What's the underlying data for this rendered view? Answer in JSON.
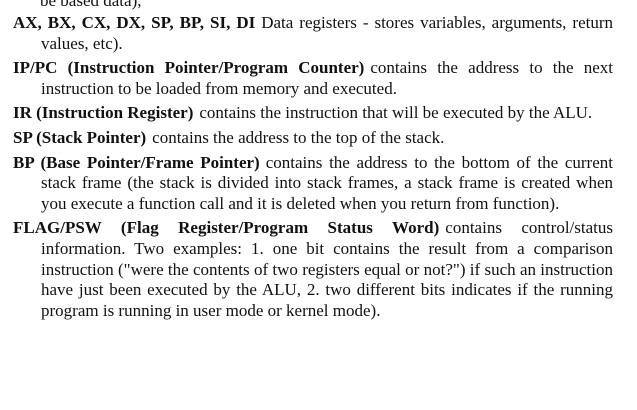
{
  "cut_text": "be based data),",
  "entries": [
    {
      "term": "AX, BX, CX, DX, SP, BP, SI, DI",
      "description": "Data registers - stores variables, arguments, return values, etc)."
    },
    {
      "term": "IP/PC (Instruction Pointer/Program Counter)",
      "description": "contains the address to the next instruction to be loaded from memory and executed."
    },
    {
      "term": "IR (Instruction Register)",
      "description": "contains the instruction that will be executed by the ALU."
    },
    {
      "term": "SP (Stack Pointer)",
      "description": "contains the address to the top of the stack."
    },
    {
      "term": "BP (Base Pointer/Frame Pointer)",
      "description": "contains the address to the bottom of the current stack frame (the stack is divided into stack frames, a stack frame is created when you execute a function call and it is deleted when you return from function)."
    },
    {
      "term": "FLAG/PSW (Flag Register/Program Status Word)",
      "description": "contains control/status information. Two examples: 1. one bit contains the result from a comparison instruction (\"were the contents of two registers equal or not?\") if such an instruction have just been executed by the ALU, 2. two different bits indicates if the running program is running in user mode or kernel mode)."
    }
  ]
}
